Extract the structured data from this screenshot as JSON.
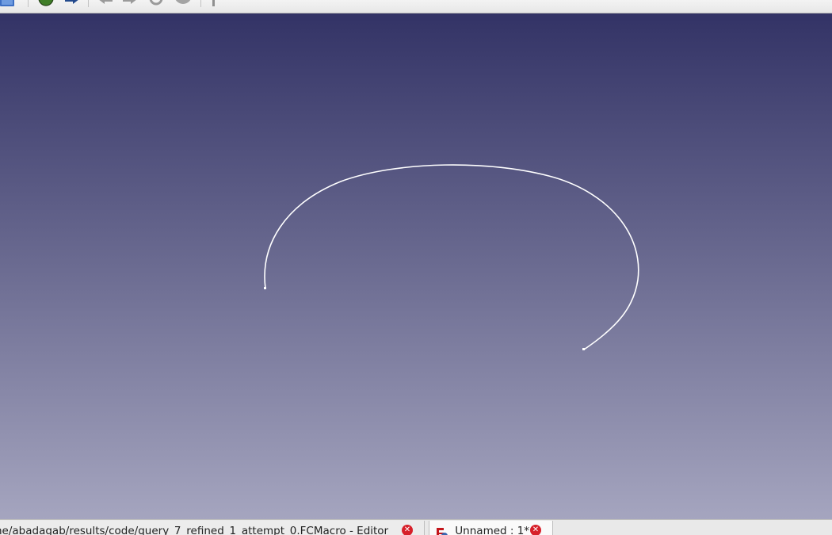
{
  "toolbar": {
    "icons": [
      "view-box-icon",
      "web-globe-icon",
      "forward-arrow-icon",
      "back-nav-icon",
      "forward-nav-icon",
      "refresh-icon",
      "stop-icon",
      "pin-icon",
      "zoom-icon"
    ]
  },
  "viewport": {
    "background_top": "#333366",
    "background_bottom": "#a5a5bf",
    "curve_color": "#ffffff"
  },
  "tabs": [
    {
      "label": "ne/abadagab/results/code/query_7_refined_1_attempt_0.FCMacro - Editor",
      "icon": "close-icon",
      "active": false
    },
    {
      "label": "Unnamed : 1*",
      "icon": "freecad-document-icon",
      "active": true
    }
  ]
}
